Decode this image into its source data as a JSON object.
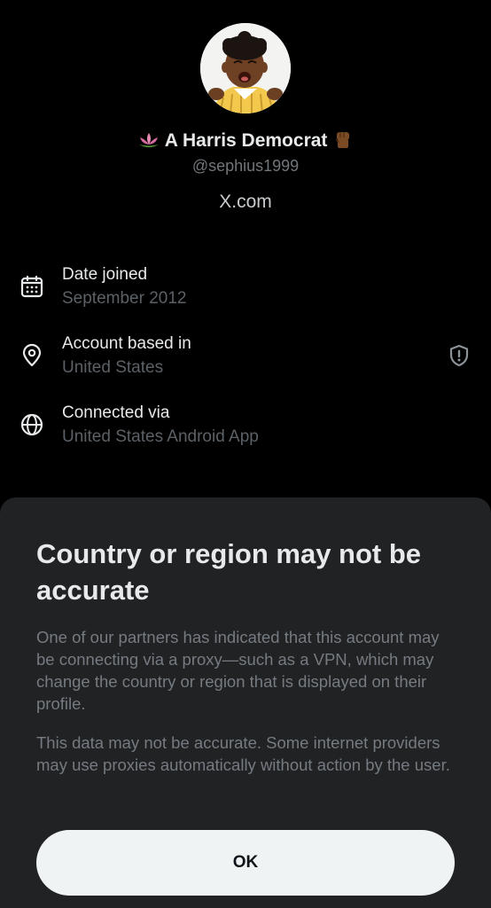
{
  "profile": {
    "display_name": "A Harris Democrat",
    "handle": "@sephius1999",
    "website": "X.com",
    "avatar_icon": "avatar-crying-child"
  },
  "details": [
    {
      "icon": "calendar-icon",
      "label": "Date joined",
      "value": "September 2012"
    },
    {
      "icon": "location-pin-icon",
      "label": "Account based in",
      "value": "United States"
    },
    {
      "icon": "globe-icon",
      "label": "Connected via",
      "value": "United States Android App"
    }
  ],
  "warning_icon": "shield-alert-icon",
  "sheet": {
    "title": "Country or region may not be accurate",
    "paragraph1": "One of our partners has indicated that this account may be connecting via a proxy—such as a VPN, which may change the country or region that is displayed on their profile.",
    "paragraph2": "This data may not be accurate. Some internet providers may use proxies automatically without action by the user.",
    "ok_label": "OK"
  },
  "colors": {
    "background": "#000000",
    "sheet_background": "#202224",
    "primary_text": "#e7e9ea",
    "secondary_text": "#71767b",
    "button_background": "#eff3f4"
  }
}
